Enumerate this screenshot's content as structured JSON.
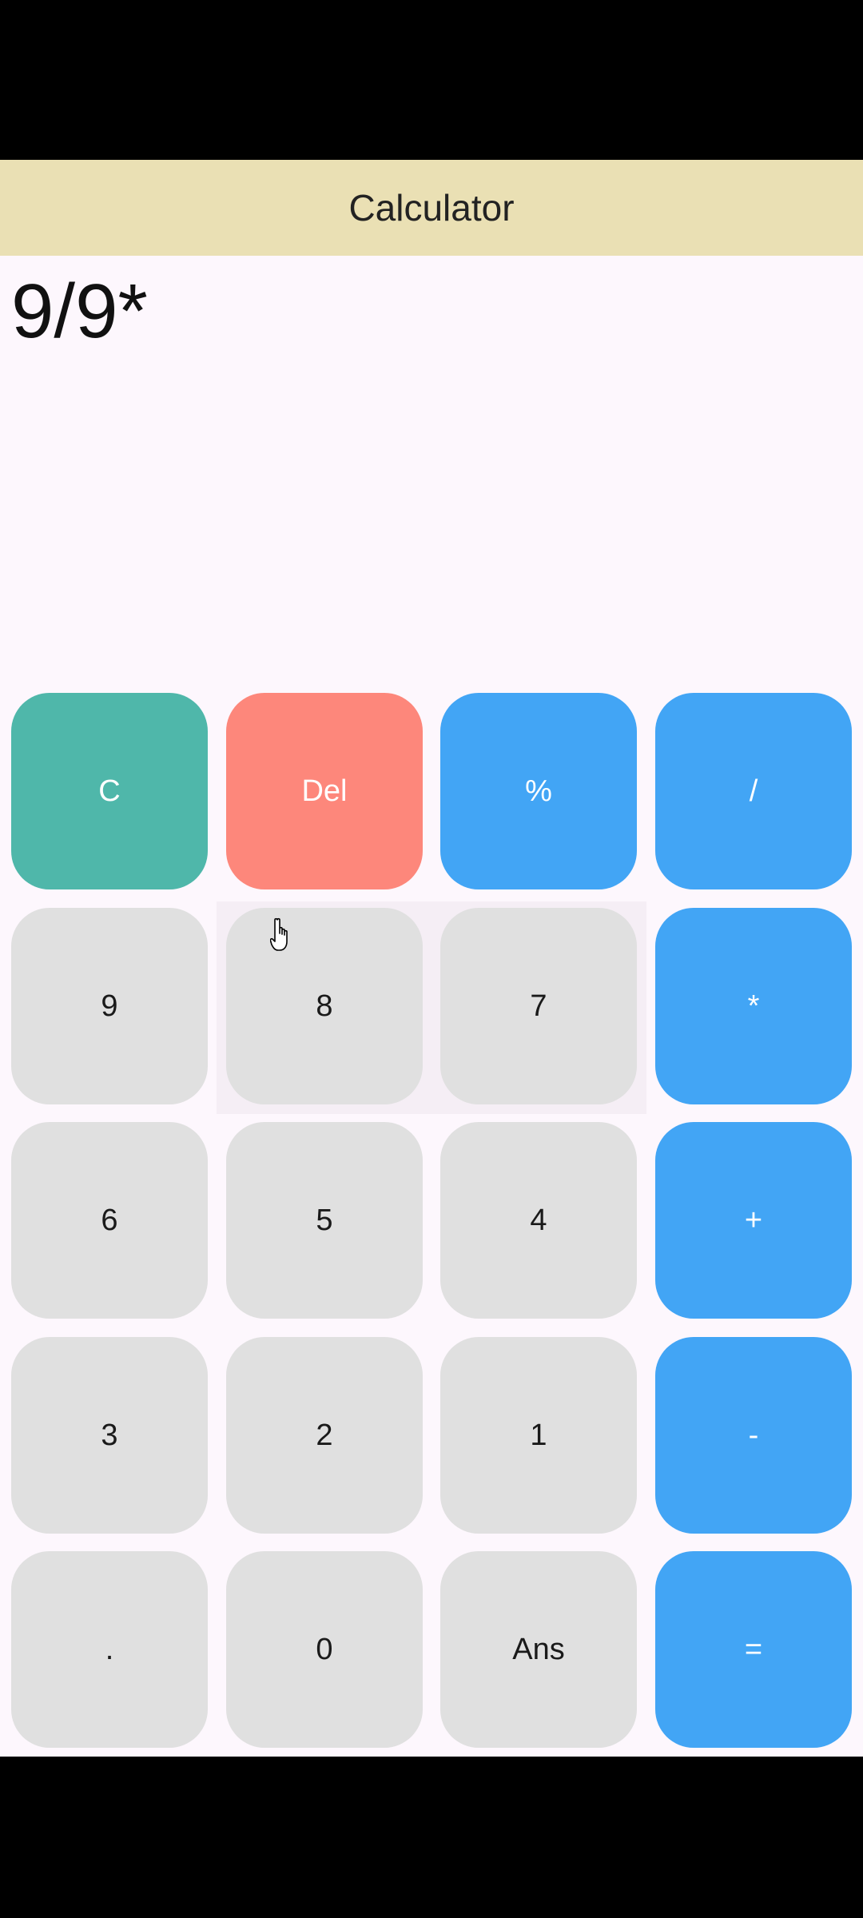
{
  "app": {
    "title": "Calculator"
  },
  "display": {
    "expression": "9/9*"
  },
  "keys": {
    "clear": "C",
    "del": "Del",
    "percent": "%",
    "divide": "/",
    "nine": "9",
    "eight": "8",
    "seven": "7",
    "multiply": "*",
    "six": "6",
    "five": "5",
    "four": "4",
    "plus": "+",
    "three": "3",
    "two": "2",
    "one": "1",
    "minus": "-",
    "dot": ".",
    "zero": "0",
    "ans": "Ans",
    "equals": "="
  },
  "colors": {
    "appbar": "#eae0b4",
    "background": "#fdf7fd",
    "clear_key": "#4fb7aa",
    "del_key": "#fd877b",
    "operator_key": "#42a5f5",
    "number_key": "#e0e0e0"
  },
  "icons": {
    "cursor": "hand-pointer-icon"
  }
}
